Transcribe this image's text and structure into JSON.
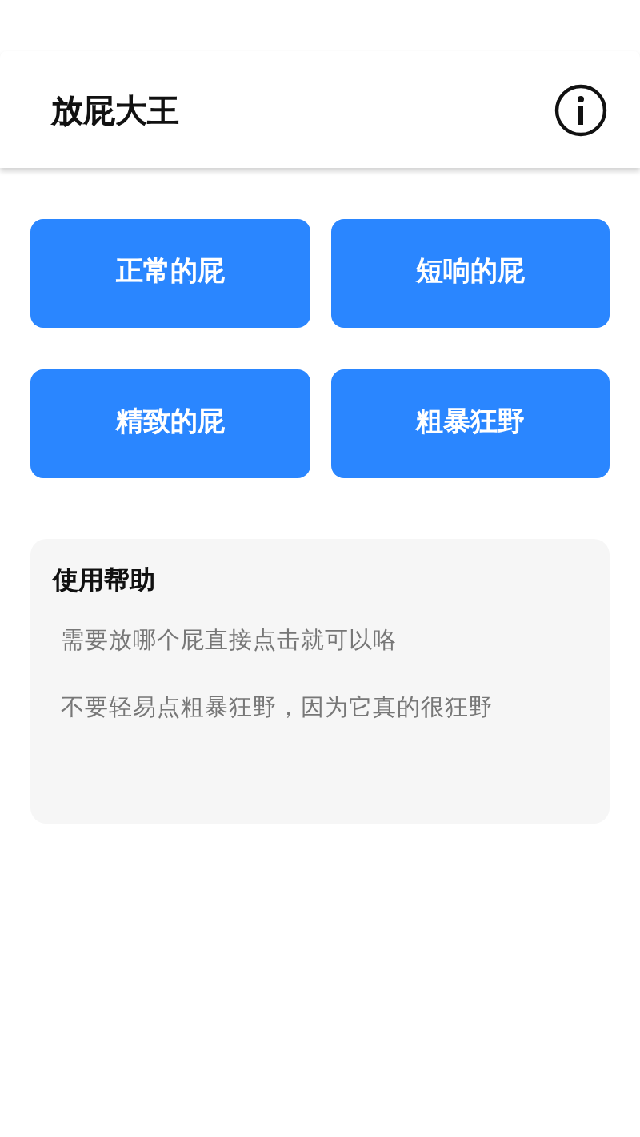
{
  "header": {
    "title": "放屁大王"
  },
  "buttons": [
    {
      "label": "正常的屁"
    },
    {
      "label": "短响的屁"
    },
    {
      "label": "精致的屁"
    },
    {
      "label": "粗暴狂野"
    }
  ],
  "help": {
    "title": "使用帮助",
    "lines": [
      "需要放哪个屁直接点击就可以咯",
      "不要轻易点粗暴狂野，因为它真的很狂野"
    ]
  }
}
